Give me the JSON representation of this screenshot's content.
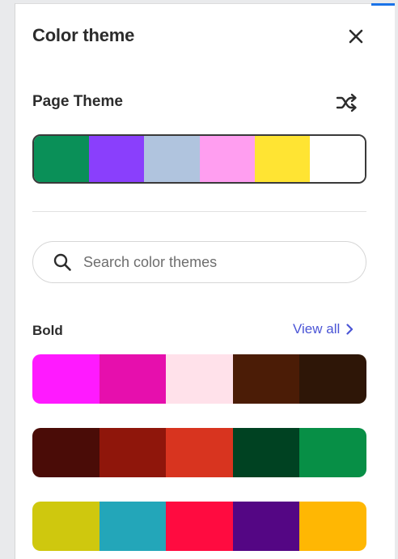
{
  "panel": {
    "title": "Color theme",
    "close_icon": "close-icon"
  },
  "page_theme": {
    "title": "Page Theme",
    "shuffle_icon": "shuffle-icon",
    "colors": [
      "#0a9058",
      "#8a3ffc",
      "#b0c4de",
      "#ff9ef0",
      "#ffe433",
      "#ffffff"
    ]
  },
  "search": {
    "placeholder": "Search color themes",
    "value": ""
  },
  "bold_group": {
    "title": "Bold",
    "view_all_label": "View all",
    "themes": [
      {
        "colors": [
          "#ff1aff",
          "#e60fad",
          "#ffe1ea",
          "#4b1c06",
          "#2e1607"
        ]
      },
      {
        "colors": [
          "#4a0c07",
          "#8f160b",
          "#d8341f",
          "#004222",
          "#078f46"
        ]
      },
      {
        "colors": [
          "#cfc80e",
          "#23a6b9",
          "#ff0b40",
          "#540684",
          "#ffb703"
        ]
      }
    ]
  }
}
